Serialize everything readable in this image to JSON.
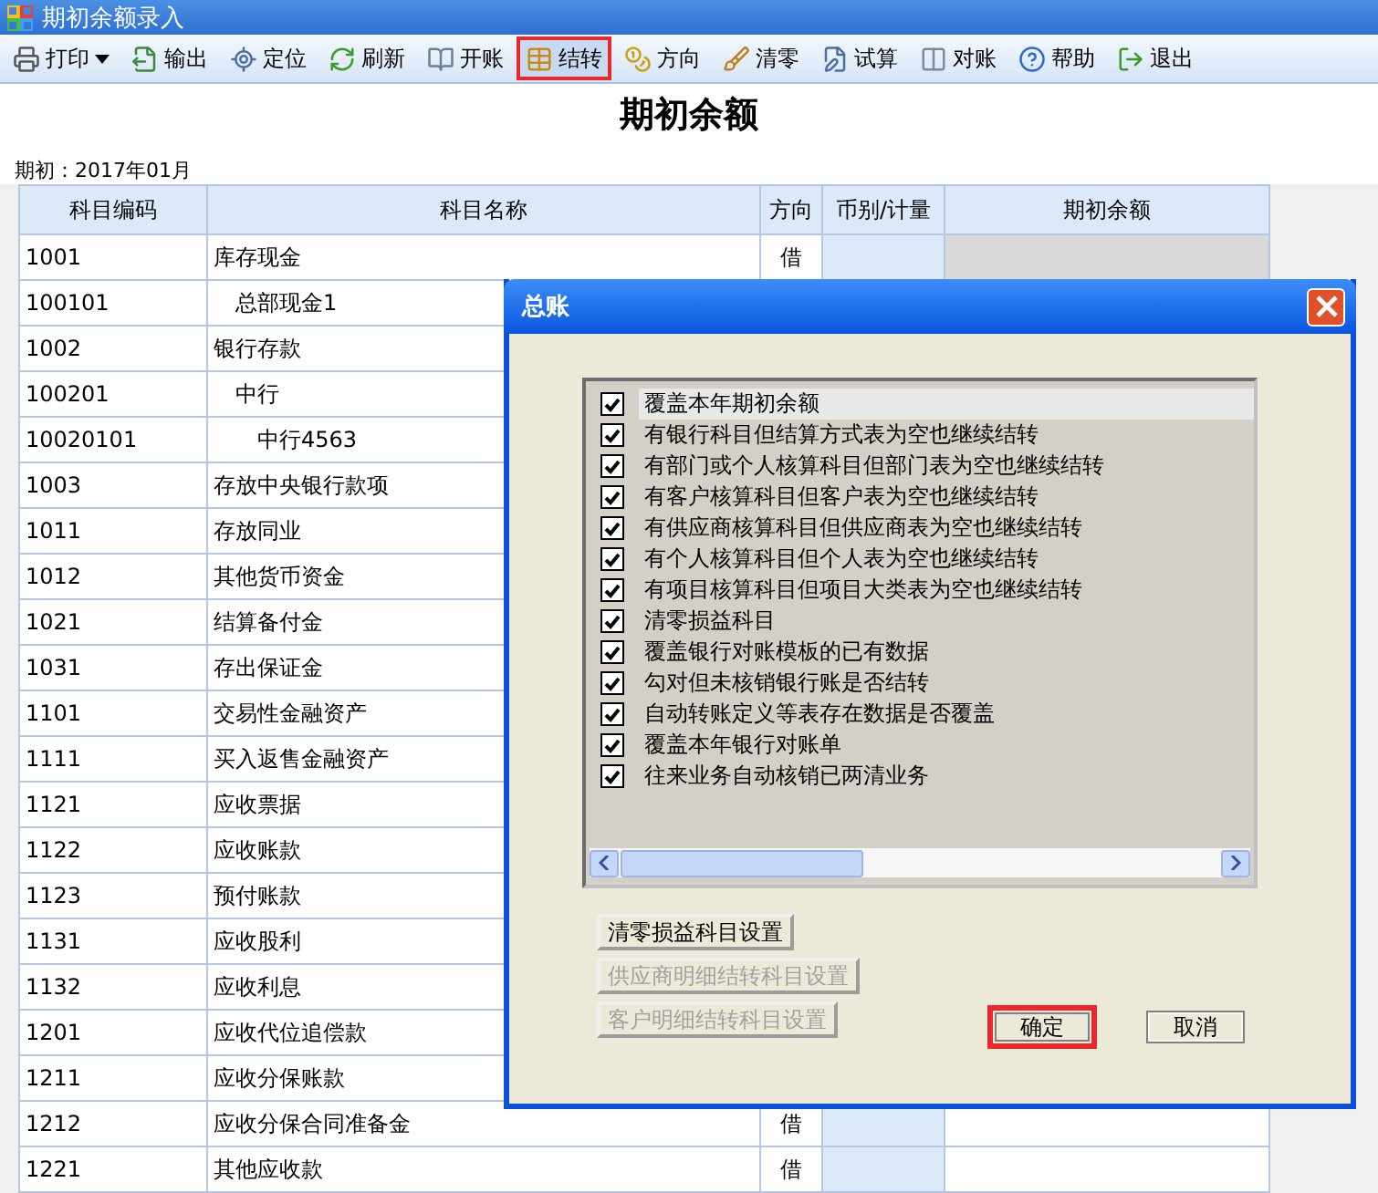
{
  "window": {
    "title": "期初余额录入"
  },
  "toolbar": [
    {
      "label": "打印",
      "dropdown": true,
      "highlighted": false
    },
    {
      "label": "输出",
      "dropdown": false,
      "highlighted": false
    },
    {
      "label": "定位",
      "dropdown": false,
      "highlighted": false
    },
    {
      "label": "刷新",
      "dropdown": false,
      "highlighted": false
    },
    {
      "label": "开账",
      "dropdown": false,
      "highlighted": false
    },
    {
      "label": "结转",
      "dropdown": false,
      "highlighted": true
    },
    {
      "label": "方向",
      "dropdown": false,
      "highlighted": false
    },
    {
      "label": "清零",
      "dropdown": false,
      "highlighted": false
    },
    {
      "label": "试算",
      "dropdown": false,
      "highlighted": false
    },
    {
      "label": "对账",
      "dropdown": false,
      "highlighted": false
    },
    {
      "label": "帮助",
      "dropdown": false,
      "highlighted": false
    },
    {
      "label": "退出",
      "dropdown": false,
      "highlighted": false
    }
  ],
  "report": {
    "title": "期初余额",
    "period": "期初：2017年01月"
  },
  "table": {
    "columns": [
      "科目编码",
      "科目名称",
      "方向",
      "币别/计量",
      "期初余额"
    ],
    "rows": [
      {
        "code": "1001",
        "name": "库存现金",
        "direction": "借",
        "calculated": true,
        "children": [
          {
            "code": "100101",
            "name": "总部现金1"
          }
        ]
      },
      {
        "code": "1002",
        "name": "银行存款",
        "children": [
          {
            "code": "100201",
            "name": "中行",
            "children": [
              {
                "code": "10020101",
                "name": "中行4563"
              }
            ]
          }
        ]
      },
      {
        "code": "1003",
        "name": "存放中央银行款项"
      },
      {
        "code": "1011",
        "name": "存放同业"
      },
      {
        "code": "1012",
        "name": "其他货币资金"
      },
      {
        "code": "1021",
        "name": "结算备付金"
      },
      {
        "code": "1031",
        "name": "存出保证金"
      },
      {
        "code": "1101",
        "name": "交易性金融资产"
      },
      {
        "code": "1111",
        "name": "买入返售金融资产"
      },
      {
        "code": "1121",
        "name": "应收票据"
      },
      {
        "code": "1122",
        "name": "应收账款"
      },
      {
        "code": "1123",
        "name": "预付账款"
      },
      {
        "code": "1131",
        "name": "应收股利"
      },
      {
        "code": "1132",
        "name": "应收利息"
      },
      {
        "code": "1201",
        "name": "应收代位追偿款"
      },
      {
        "code": "1211",
        "name": "应收分保账款"
      },
      {
        "code": "1212",
        "name": "应收分保合同准备金",
        "direction": "借"
      },
      {
        "code": "1221",
        "name": "其他应收款",
        "direction": "借"
      }
    ]
  },
  "dialog": {
    "title": "总账",
    "options": [
      {
        "label": "覆盖本年期初余额",
        "checked": true,
        "selected": true
      },
      {
        "label": "有银行科目但结算方式表为空也继续结转",
        "checked": true,
        "selected": false
      },
      {
        "label": "有部门或个人核算科目但部门表为空也继续结转",
        "checked": true,
        "selected": false
      },
      {
        "label": "有客户核算科目但客户表为空也继续结转",
        "checked": true,
        "selected": false
      },
      {
        "label": "有供应商核算科目但供应商表为空也继续结转",
        "checked": true,
        "selected": false
      },
      {
        "label": "有个人核算科目但个人表为空也继续结转",
        "checked": true,
        "selected": false
      },
      {
        "label": "有项目核算科目但项目大类表为空也继续结转",
        "checked": true,
        "selected": false
      },
      {
        "label": "清零损益科目",
        "checked": true,
        "selected": false
      },
      {
        "label": "覆盖银行对账模板的已有数据",
        "checked": true,
        "selected": false
      },
      {
        "label": "勾对但未核销银行账是否结转",
        "checked": true,
        "selected": false
      },
      {
        "label": "自动转账定义等表存在数据是否覆盖",
        "checked": true,
        "selected": false
      },
      {
        "label": "覆盖本年银行对账单",
        "checked": true,
        "selected": false
      },
      {
        "label": "往来业务自动核销已两清业务",
        "checked": true,
        "selected": false
      }
    ],
    "setting_buttons": [
      {
        "label": "清零损益科目设置",
        "disabled": false
      },
      {
        "label": "供应商明细结转科目设置",
        "disabled": true
      },
      {
        "label": "客户明细结转科目设置",
        "disabled": true
      }
    ],
    "ok_button": {
      "label": "确定",
      "highlighted": true
    },
    "cancel_button": {
      "label": "取消",
      "highlighted": false
    }
  }
}
